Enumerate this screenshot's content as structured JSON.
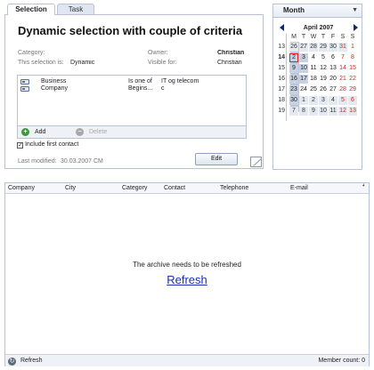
{
  "tabs": [
    {
      "label": "Selection"
    },
    {
      "label": "Task"
    }
  ],
  "selection": {
    "title": "Dynamic selection with couple of criteria",
    "category_label": "Category:",
    "category_value": "",
    "type_label": "This selection is:",
    "type_value": "Dynamic",
    "owner_label": "Owner:",
    "owner_value": "Christian",
    "visible_label": "Visible for:",
    "visible_value": "Christian",
    "criteria": [
      {
        "field": "Business",
        "operator": "Is one of",
        "value": "IT og telecom"
      },
      {
        "field": "Company",
        "operator": "Begins...",
        "value": "c"
      }
    ],
    "toolbar": {
      "add_label": "Add",
      "delete_label": "Delete"
    },
    "include_first_contact_label": "Include first contact",
    "last_modified_label": "Last modified:",
    "last_modified_value": "30.03.2007 CM",
    "edit_label": "Edit"
  },
  "calendar": {
    "view_label": "Month",
    "title": "April 2007",
    "weekdays": [
      "M",
      "T",
      "W",
      "T",
      "F",
      "S",
      "S"
    ],
    "weeks": [
      {
        "week": "13",
        "days": [
          "26",
          "27",
          "28",
          "29",
          "30",
          "31",
          "1"
        ]
      },
      {
        "week": "14",
        "days": [
          "2",
          "3",
          "4",
          "5",
          "6",
          "7",
          "8"
        ]
      },
      {
        "week": "15",
        "days": [
          "9",
          "10",
          "11",
          "12",
          "13",
          "14",
          "15"
        ]
      },
      {
        "week": "16",
        "days": [
          "16",
          "17",
          "18",
          "19",
          "20",
          "21",
          "22"
        ]
      },
      {
        "week": "17",
        "days": [
          "23",
          "24",
          "25",
          "26",
          "27",
          "28",
          "29"
        ]
      },
      {
        "week": "18",
        "days": [
          "30",
          "1",
          "2",
          "3",
          "4",
          "5",
          "6"
        ]
      },
      {
        "week": "19",
        "days": [
          "7",
          "8",
          "9",
          "10",
          "11",
          "12",
          "13"
        ]
      }
    ],
    "today": "2"
  },
  "list": {
    "columns": [
      "Company",
      "City",
      "Category",
      "Contact",
      "Telephone",
      "E-mail"
    ],
    "message": "The archive needs to be refreshed",
    "refresh_link": "Refresh"
  },
  "status": {
    "refresh_label": "Refresh",
    "member_count": "Member count: 0"
  }
}
